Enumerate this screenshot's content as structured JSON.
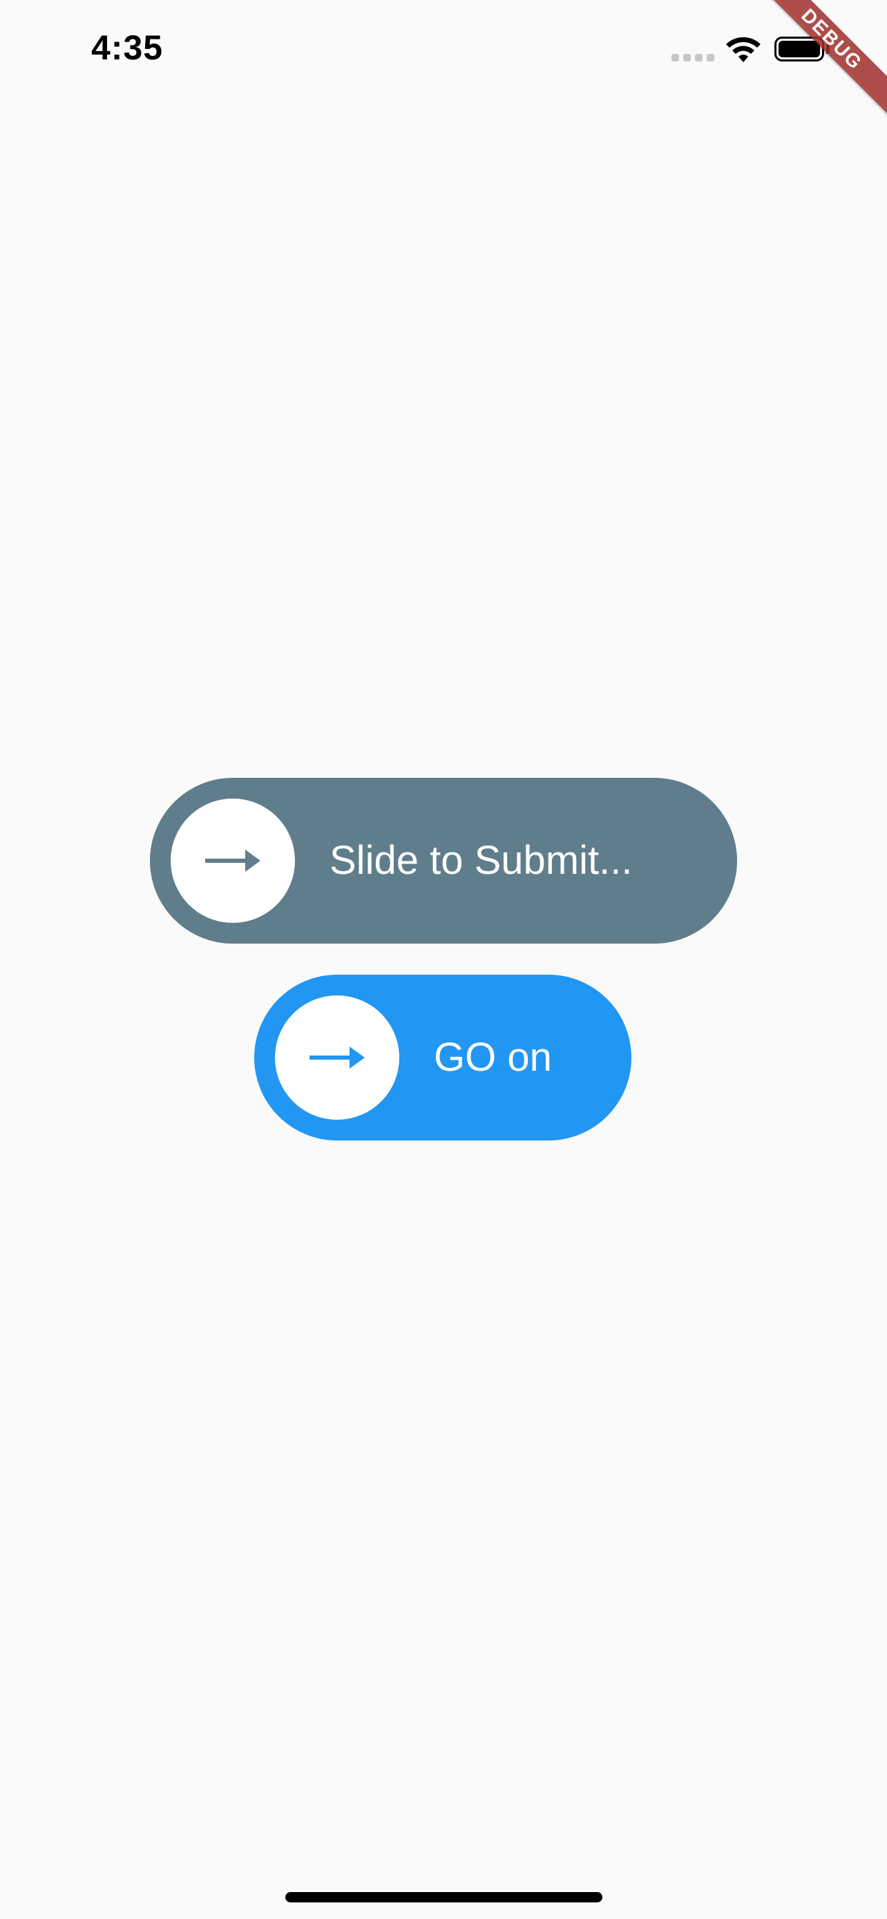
{
  "status_bar": {
    "time": "4:35",
    "wifi_icon": "wifi-icon",
    "battery_icon": "battery-icon"
  },
  "debug_banner": {
    "label": "DEBUG",
    "color": "#a0302d"
  },
  "sliders": [
    {
      "label": "Slide to Submit...",
      "icon": "arrow-right-icon",
      "color": "#607d8b"
    },
    {
      "label": "GO on",
      "icon": "arrow-right-icon",
      "color": "#2196f3"
    }
  ],
  "colors": {
    "background": "#fafafa",
    "knob": "#ffffff"
  }
}
